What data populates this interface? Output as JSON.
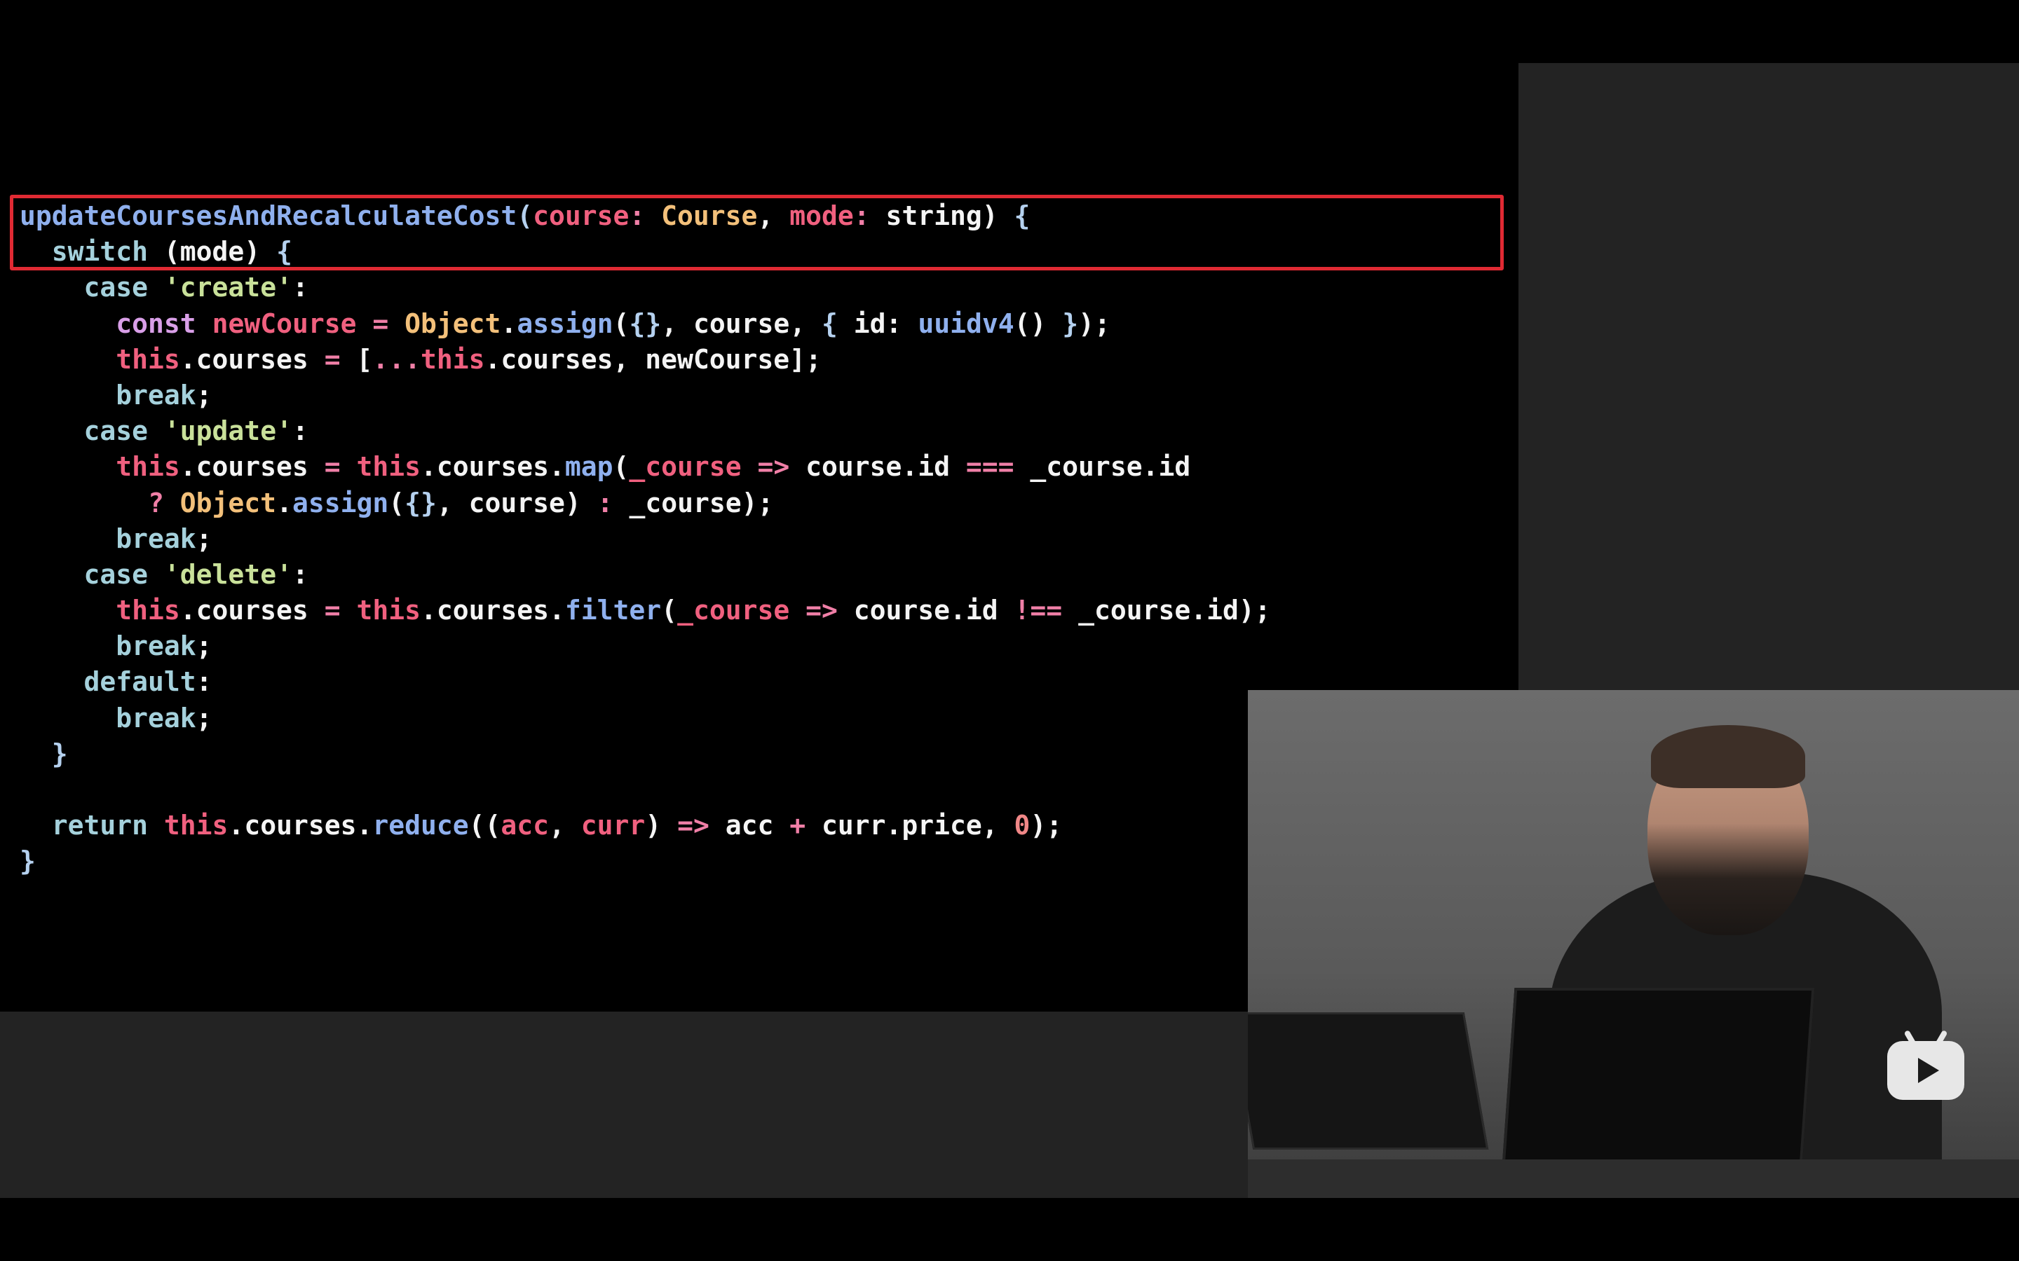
{
  "code": {
    "lines": [
      [
        {
          "t": "updateCoursesAndRecalculateCost",
          "c": "fn"
        },
        {
          "t": "(",
          "c": "punc"
        },
        {
          "t": "course",
          "c": "param"
        },
        {
          "t": ": ",
          "c": "op"
        },
        {
          "t": "Course",
          "c": "type"
        },
        {
          "t": ", ",
          "c": "plain"
        },
        {
          "t": "mode",
          "c": "param"
        },
        {
          "t": ": ",
          "c": "op"
        },
        {
          "t": "string",
          "c": "plain"
        },
        {
          "t": ") ",
          "c": "plain"
        },
        {
          "t": "{",
          "c": "punc"
        }
      ],
      [
        {
          "t": "  switch",
          "c": "kw"
        },
        {
          "t": " (mode) ",
          "c": "plain"
        },
        {
          "t": "{",
          "c": "punc"
        }
      ],
      [
        {
          "t": "    case",
          "c": "kw"
        },
        {
          "t": " ",
          "c": "plain"
        },
        {
          "t": "'create'",
          "c": "str"
        },
        {
          "t": ":",
          "c": "plain"
        }
      ],
      [
        {
          "t": "      const",
          "c": "const"
        },
        {
          "t": " ",
          "c": "plain"
        },
        {
          "t": "newCourse",
          "c": "param"
        },
        {
          "t": " ",
          "c": "plain"
        },
        {
          "t": "=",
          "c": "op"
        },
        {
          "t": " ",
          "c": "plain"
        },
        {
          "t": "Object",
          "c": "type"
        },
        {
          "t": ".",
          "c": "plain"
        },
        {
          "t": "assign",
          "c": "fn"
        },
        {
          "t": "(",
          "c": "plain"
        },
        {
          "t": "{}",
          "c": "punc"
        },
        {
          "t": ", course, ",
          "c": "plain"
        },
        {
          "t": "{",
          "c": "punc"
        },
        {
          "t": " id: ",
          "c": "plain"
        },
        {
          "t": "uuidv4",
          "c": "fn"
        },
        {
          "t": "() ",
          "c": "plain"
        },
        {
          "t": "}",
          "c": "punc"
        },
        {
          "t": ");",
          "c": "plain"
        }
      ],
      [
        {
          "t": "      this",
          "c": "this"
        },
        {
          "t": ".courses ",
          "c": "plain"
        },
        {
          "t": "=",
          "c": "op"
        },
        {
          "t": " [",
          "c": "plain"
        },
        {
          "t": "...",
          "c": "op"
        },
        {
          "t": "this",
          "c": "this"
        },
        {
          "t": ".courses, newCourse];",
          "c": "plain"
        }
      ],
      [
        {
          "t": "      break",
          "c": "kw"
        },
        {
          "t": ";",
          "c": "plain"
        }
      ],
      [
        {
          "t": "    case",
          "c": "kw"
        },
        {
          "t": " ",
          "c": "plain"
        },
        {
          "t": "'update'",
          "c": "str"
        },
        {
          "t": ":",
          "c": "plain"
        }
      ],
      [
        {
          "t": "      this",
          "c": "this"
        },
        {
          "t": ".courses ",
          "c": "plain"
        },
        {
          "t": "=",
          "c": "op"
        },
        {
          "t": " ",
          "c": "plain"
        },
        {
          "t": "this",
          "c": "this"
        },
        {
          "t": ".courses.",
          "c": "plain"
        },
        {
          "t": "map",
          "c": "fn"
        },
        {
          "t": "(",
          "c": "plain"
        },
        {
          "t": "_course",
          "c": "param"
        },
        {
          "t": " ",
          "c": "plain"
        },
        {
          "t": "=>",
          "c": "op"
        },
        {
          "t": " course.id ",
          "c": "plain"
        },
        {
          "t": "===",
          "c": "op"
        },
        {
          "t": " _course.id",
          "c": "plain"
        }
      ],
      [
        {
          "t": "        ?",
          "c": "op"
        },
        {
          "t": " ",
          "c": "plain"
        },
        {
          "t": "Object",
          "c": "type"
        },
        {
          "t": ".",
          "c": "plain"
        },
        {
          "t": "assign",
          "c": "fn"
        },
        {
          "t": "(",
          "c": "plain"
        },
        {
          "t": "{}",
          "c": "punc"
        },
        {
          "t": ", course) ",
          "c": "plain"
        },
        {
          "t": ":",
          "c": "op"
        },
        {
          "t": " _course);",
          "c": "plain"
        }
      ],
      [
        {
          "t": "      break",
          "c": "kw"
        },
        {
          "t": ";",
          "c": "plain"
        }
      ],
      [
        {
          "t": "    case",
          "c": "kw"
        },
        {
          "t": " ",
          "c": "plain"
        },
        {
          "t": "'delete'",
          "c": "str"
        },
        {
          "t": ":",
          "c": "plain"
        }
      ],
      [
        {
          "t": "      this",
          "c": "this"
        },
        {
          "t": ".courses ",
          "c": "plain"
        },
        {
          "t": "=",
          "c": "op"
        },
        {
          "t": " ",
          "c": "plain"
        },
        {
          "t": "this",
          "c": "this"
        },
        {
          "t": ".courses.",
          "c": "plain"
        },
        {
          "t": "filter",
          "c": "fn"
        },
        {
          "t": "(",
          "c": "plain"
        },
        {
          "t": "_course",
          "c": "param"
        },
        {
          "t": " ",
          "c": "plain"
        },
        {
          "t": "=>",
          "c": "op"
        },
        {
          "t": " course.id ",
          "c": "plain"
        },
        {
          "t": "!==",
          "c": "op"
        },
        {
          "t": " _course.id);",
          "c": "plain"
        }
      ],
      [
        {
          "t": "      break",
          "c": "kw"
        },
        {
          "t": ";",
          "c": "plain"
        }
      ],
      [
        {
          "t": "    default",
          "c": "kw"
        },
        {
          "t": ":",
          "c": "plain"
        }
      ],
      [
        {
          "t": "      break",
          "c": "kw"
        },
        {
          "t": ";",
          "c": "plain"
        }
      ],
      [
        {
          "t": "  }",
          "c": "punc"
        }
      ],
      [
        {
          "t": "",
          "c": "plain"
        }
      ],
      [
        {
          "t": "  return",
          "c": "kw"
        },
        {
          "t": " ",
          "c": "plain"
        },
        {
          "t": "this",
          "c": "this"
        },
        {
          "t": ".courses.",
          "c": "plain"
        },
        {
          "t": "reduce",
          "c": "fn"
        },
        {
          "t": "((",
          "c": "plain"
        },
        {
          "t": "acc",
          "c": "param"
        },
        {
          "t": ", ",
          "c": "plain"
        },
        {
          "t": "curr",
          "c": "param"
        },
        {
          "t": ") ",
          "c": "plain"
        },
        {
          "t": "=>",
          "c": "op"
        },
        {
          "t": " acc ",
          "c": "plain"
        },
        {
          "t": "+",
          "c": "op"
        },
        {
          "t": " curr.price, ",
          "c": "plain"
        },
        {
          "t": "0",
          "c": "num"
        },
        {
          "t": ");",
          "c": "plain"
        }
      ],
      [
        {
          "t": "}",
          "c": "punc"
        }
      ]
    ]
  },
  "highlight": {
    "color": "#e02a33",
    "covers_lines": [
      1,
      2
    ]
  },
  "colors": {
    "background": "#000000",
    "panel": "#232323",
    "highlight_border": "#e02a33"
  },
  "icons": {
    "logo": "bilibili-tv-play-icon"
  }
}
